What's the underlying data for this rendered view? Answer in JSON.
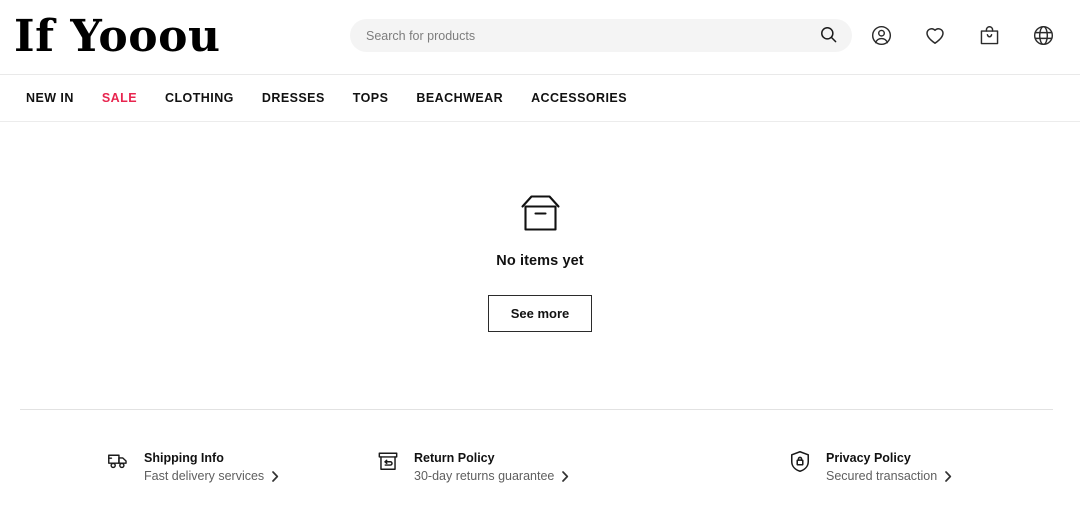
{
  "header": {
    "logo": "If Yooou",
    "search": {
      "placeholder": "Search for products",
      "value": "",
      "icon": "search-icon"
    },
    "icons": [
      {
        "name": "account-icon",
        "label": "Account"
      },
      {
        "name": "wishlist-heart-icon",
        "label": "Wishlist"
      },
      {
        "name": "shopping-bag-icon",
        "label": "Bag"
      },
      {
        "name": "globe-language-icon",
        "label": "Language"
      }
    ]
  },
  "nav": {
    "items": [
      {
        "label": "NEW IN",
        "highlight": false
      },
      {
        "label": "SALE",
        "highlight": true
      },
      {
        "label": "CLOTHING",
        "highlight": false
      },
      {
        "label": "DRESSES",
        "highlight": false
      },
      {
        "label": "TOPS",
        "highlight": false
      },
      {
        "label": "BEACHWEAR",
        "highlight": false
      },
      {
        "label": "ACCESSORIES",
        "highlight": false
      }
    ],
    "sale_color": "#e8254f"
  },
  "main": {
    "empty_icon": "open-box-icon",
    "empty_title": "No items yet",
    "see_more_label": "See more"
  },
  "footer": {
    "items": [
      {
        "icon": "delivery-truck-icon",
        "title": "Shipping Info",
        "subtitle": "Fast delivery services"
      },
      {
        "icon": "return-box-icon",
        "title": "Return Policy",
        "subtitle": "30-day returns guarantee"
      },
      {
        "icon": "shield-lock-icon",
        "title": "Privacy Policy",
        "subtitle": "Secured transaction"
      }
    ]
  }
}
